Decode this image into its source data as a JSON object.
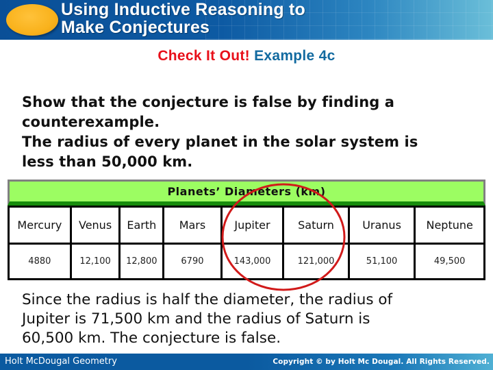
{
  "header": {
    "title_line1": "Using Inductive Reasoning to",
    "title_line2": "Make Conjectures",
    "badge_icon": "orange-oval-icon"
  },
  "example": {
    "label_highlight": "Check It Out!",
    "label": "Example 4c",
    "highlight_color": "#e8101a",
    "label_color": "#126aa0"
  },
  "problem": {
    "lines": [
      "Show that the conjecture is false by finding a",
      "counterexample.",
      "The radius of every planet in the solar system is",
      "less than 50,000 km."
    ]
  },
  "table": {
    "title": "Planets’ Diameters (km)",
    "header_color": "#9cfd62",
    "planets": [
      "Mercury",
      "Venus",
      "Earth",
      "Mars",
      "Jupiter",
      "Saturn",
      "Uranus",
      "Neptune"
    ],
    "diameters": [
      "4880",
      "12,100",
      "12,800",
      "6790",
      "143,000",
      "121,000",
      "51,100",
      "49,500"
    ],
    "highlighted": [
      "Jupiter",
      "Saturn"
    ],
    "highlight_color": "#d11a1a"
  },
  "conclusion": {
    "lines": [
      "Since the radius is half the diameter, the radius of",
      "Jupiter is 71,500 km and the radius of Saturn is",
      "60,500 km. The conjecture is false."
    ]
  },
  "footer": {
    "left": "Holt McDougal Geometry",
    "right": "Copyright © by Holt Mc Dougal. All Rights Reserved."
  }
}
